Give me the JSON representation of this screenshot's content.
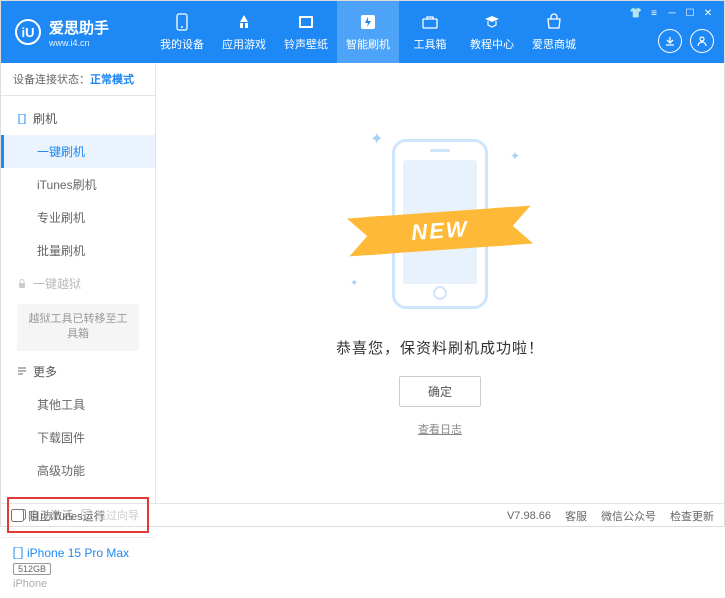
{
  "logo": {
    "icon": "iU",
    "title": "爱思助手",
    "subtitle": "www.i4.cn"
  },
  "nav": [
    {
      "label": "我的设备"
    },
    {
      "label": "应用游戏"
    },
    {
      "label": "铃声壁纸"
    },
    {
      "label": "智能刷机"
    },
    {
      "label": "工具箱"
    },
    {
      "label": "教程中心"
    },
    {
      "label": "爱思商城"
    }
  ],
  "nav_active_index": 3,
  "status": {
    "label": "设备连接状态：",
    "value": "正常模式"
  },
  "menu": {
    "section1": {
      "header": "刷机",
      "items": [
        "一键刷机",
        "iTunes刷机",
        "专业刷机",
        "批量刷机"
      ],
      "active_index": 0
    },
    "section2": {
      "header": "一键越狱",
      "note": "越狱工具已转移至工具箱"
    },
    "section3": {
      "header": "更多",
      "items": [
        "其他工具",
        "下载固件",
        "高级功能"
      ]
    }
  },
  "checkboxes": {
    "auto_activate": "自动激活",
    "skip_guide": "跳过向导"
  },
  "device": {
    "name": "iPhone 15 Pro Max",
    "storage": "512GB",
    "type": "iPhone"
  },
  "main": {
    "ribbon": "NEW",
    "success": "恭喜您，保资料刷机成功啦！",
    "confirm": "确定",
    "log_link": "查看日志"
  },
  "footer": {
    "block_itunes": "阻止iTunes运行",
    "version": "V7.98.66",
    "links": [
      "客服",
      "微信公众号",
      "检查更新"
    ]
  }
}
